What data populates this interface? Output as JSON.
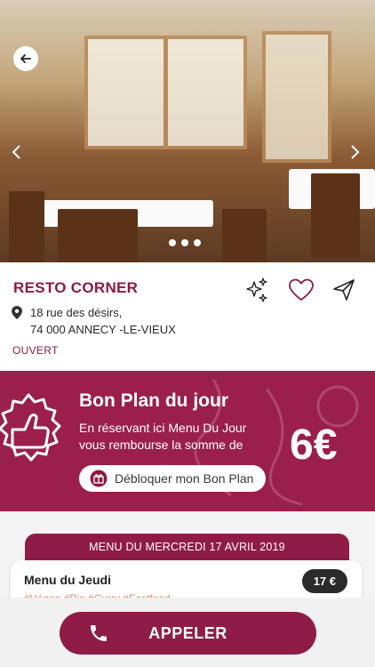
{
  "restaurant": {
    "name": "RESTO CORNER",
    "address_line1": "18 rue des désirs,",
    "address_line2": "74 000 ANNECY -LE-VIEUX",
    "status": "OUVERT"
  },
  "carousel": {
    "page_count": 3
  },
  "promo": {
    "title": "Bon Plan du jour",
    "text_line1": "En réservant ici Menu Du Jour",
    "text_line2": "vous rembourse la somme de",
    "amount": "6€",
    "unlock_label": "Débloquer mon Bon Plan"
  },
  "menu": {
    "header": "MENU DU MERCREDI 17 AVRIL 2019",
    "items": [
      {
        "name": "Menu du Jeudi",
        "tags": "#Végan  #Bio  #Curry  #Fastfood",
        "price": "17 €"
      }
    ]
  },
  "call": {
    "label": "APPELER"
  },
  "colors": {
    "brand": "#8b1a42",
    "price_pill": "#2a2a2a",
    "tags": "#c98f6e"
  }
}
